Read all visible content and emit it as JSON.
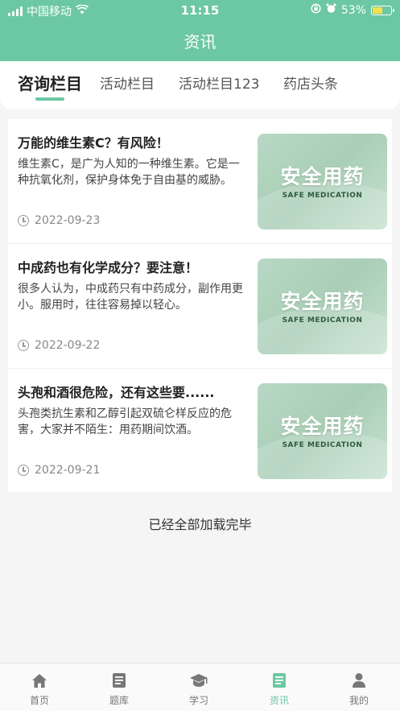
{
  "status_bar": {
    "carrier": "中国移动",
    "time": "11:15",
    "battery": "53%"
  },
  "header": {
    "title": "资讯"
  },
  "tabs": [
    {
      "label": "咨询栏目",
      "active": true
    },
    {
      "label": "活动栏目",
      "active": false
    },
    {
      "label": "活动栏目123",
      "active": false
    },
    {
      "label": "药店头条",
      "active": false
    }
  ],
  "articles": [
    {
      "title": "万能的维生素C？有风险！",
      "desc": "维生素C，是广为人知的一种维生素。它是一种抗氧化剂，保护身体免于自由基的威胁。",
      "date": "2022-09-23",
      "thumb_title": "安全用药",
      "thumb_sub": "SAFE MEDICATION"
    },
    {
      "title": "中成药也有化学成分？要注意！",
      "desc": "很多人认为，中成药只有中药成分，副作用更小。服用时，往往容易掉以轻心。",
      "date": "2022-09-22",
      "thumb_title": "安全用药",
      "thumb_sub": "SAFE MEDICATION"
    },
    {
      "title": "头孢和酒很危险，还有这些要......",
      "desc": "头孢类抗生素和乙醇引起双硫仑样反应的危害，大家并不陌生：用药期间饮酒。",
      "date": "2022-09-21",
      "thumb_title": "安全用药",
      "thumb_sub": "SAFE MEDICATION"
    }
  ],
  "footer_text": "已经全部加载完毕",
  "tabbar": [
    {
      "label": "首页",
      "icon": "home-icon",
      "active": false
    },
    {
      "label": "题库",
      "icon": "question-bank-icon",
      "active": false
    },
    {
      "label": "学习",
      "icon": "graduation-cap-icon",
      "active": false
    },
    {
      "label": "资讯",
      "icon": "news-icon",
      "active": true
    },
    {
      "label": "我的",
      "icon": "user-icon",
      "active": false
    }
  ],
  "colors": {
    "primary": "#6cc7a4",
    "background": "#f5f5f5",
    "text": "#222222"
  }
}
